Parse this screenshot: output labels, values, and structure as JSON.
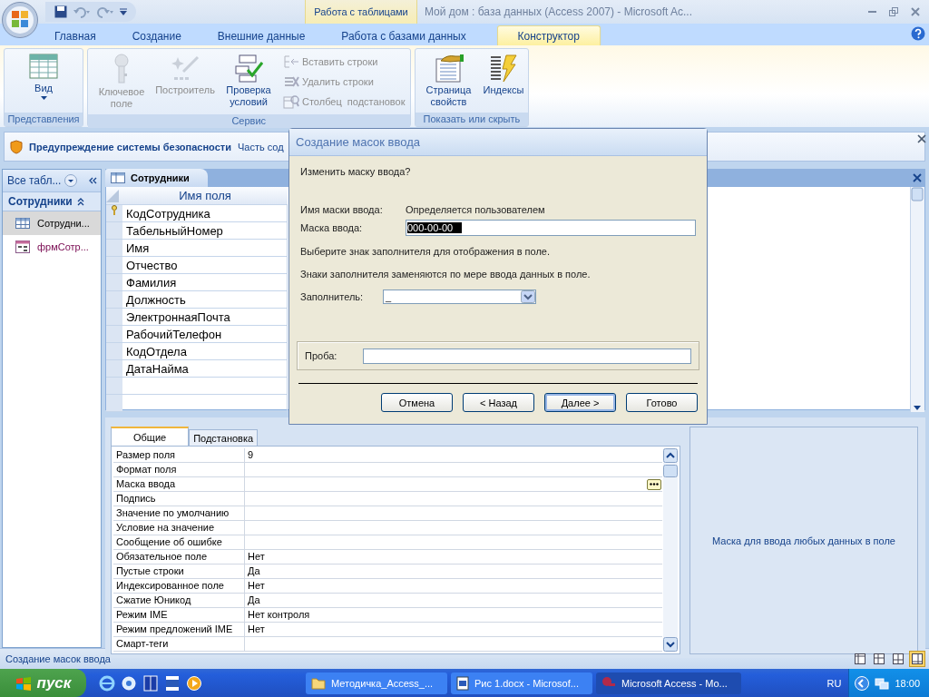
{
  "window": {
    "title": "Мой дом : база данных (Access 2007) - Microsoft Ac...",
    "contextual_group": "Работа с таблицами"
  },
  "ribbon_tabs": [
    {
      "label": "Главная",
      "selected": false
    },
    {
      "label": "Создание",
      "selected": false
    },
    {
      "label": "Внешние данные",
      "selected": false
    },
    {
      "label": "Работа с базами данных",
      "selected": false
    },
    {
      "label": "Конструктор",
      "selected": true
    }
  ],
  "ribbon_groups": [
    {
      "label": "Представления",
      "buttons": [
        {
          "label": "Вид",
          "kind": "menu",
          "disabled": false
        }
      ]
    },
    {
      "label": "Сервис",
      "buttons": [
        {
          "label": "Ключевое поле",
          "kind": "large",
          "disabled": true
        },
        {
          "label": "Построитель",
          "kind": "large",
          "disabled": true
        },
        {
          "label": "Проверка условий",
          "kind": "large",
          "disabled": false
        },
        {
          "label": "Вставить строки",
          "kind": "small",
          "disabled": true
        },
        {
          "label": "Удалить строки",
          "kind": "small",
          "disabled": true
        },
        {
          "label": "Столбец  подстановок",
          "kind": "small",
          "disabled": true
        }
      ]
    },
    {
      "label": "Показать или скрыть",
      "buttons": [
        {
          "label": "Страница свойств",
          "kind": "large",
          "disabled": false
        },
        {
          "label": "Индексы",
          "kind": "large",
          "disabled": false
        }
      ]
    }
  ],
  "security_bar": {
    "title": "Предупреждение системы безопасности",
    "text": "Часть сод"
  },
  "nav_pane": {
    "header": "Все табл...",
    "group": {
      "label": "Сотрудники",
      "expanded": true
    },
    "items": [
      {
        "label": "Сотрудни...",
        "kind": "table",
        "selected": true
      },
      {
        "label": "фрмСотр...",
        "kind": "form",
        "selected": false
      }
    ]
  },
  "document_tab": {
    "label": "Сотрудники"
  },
  "design_grid": {
    "column": "Имя поля",
    "rows": [
      {
        "name": "КодСотрудника",
        "primary_key": true
      },
      {
        "name": "ТабельныйНомер",
        "primary_key": false
      },
      {
        "name": "Имя",
        "primary_key": false
      },
      {
        "name": "Отчество",
        "primary_key": false
      },
      {
        "name": "Фамилия",
        "primary_key": false
      },
      {
        "name": "Должность",
        "primary_key": false
      },
      {
        "name": "ЭлектроннаяПочта",
        "primary_key": false
      },
      {
        "name": "РабочийТелефон",
        "primary_key": false
      },
      {
        "name": "КодОтдела",
        "primary_key": false
      },
      {
        "name": "ДатаНайма",
        "primary_key": false
      }
    ]
  },
  "field_properties": {
    "tabs": [
      {
        "label": "Общие",
        "selected": true
      },
      {
        "label": "Подстановка",
        "selected": false
      }
    ],
    "rows": [
      {
        "label": "Размер поля",
        "value": "9",
        "has_builder": false
      },
      {
        "label": "Формат поля",
        "has_builder": false
      },
      {
        "label": "Маска ввода",
        "has_builder": true
      },
      {
        "label": "Подпись",
        "has_builder": false
      },
      {
        "label": "Значение по умолчанию",
        "has_builder": false
      },
      {
        "label": "Условие на значение",
        "has_builder": false
      },
      {
        "label": "Сообщение об ошибке",
        "has_builder": false
      },
      {
        "label": "Обязательное поле",
        "value": "Нет",
        "has_builder": false
      },
      {
        "label": "Пустые строки",
        "value": "Да",
        "has_builder": false
      },
      {
        "label": "Индексированное поле",
        "value": "Нет",
        "has_builder": false
      },
      {
        "label": "Сжатие Юникод",
        "value": "Да",
        "has_builder": false
      },
      {
        "label": "Режим IME",
        "value": "Нет контроля",
        "has_builder": false
      },
      {
        "label": "Режим предложений IME",
        "value": "Нет",
        "has_builder": false
      },
      {
        "label": "Смарт-теги",
        "has_builder": false
      }
    ],
    "help": "Маска для ввода любых данных в поле"
  },
  "dialog": {
    "title": "Создание масок ввода",
    "question": "Изменить маску ввода?",
    "mask_name": {
      "label": "Имя маски ввода:",
      "value": "Определяется пользователем"
    },
    "mask": {
      "label": "Маска ввода:",
      "value": "000-00-00",
      "value_selected": true
    },
    "hints": [
      "Выберите знак заполнителя для отображения в поле.",
      "Знаки заполнителя заменяются по мере ввода данных в поле."
    ],
    "placeholder_char": {
      "label": "Заполнитель:",
      "value": "_"
    },
    "test": {
      "label": "Проба:"
    },
    "buttons": [
      {
        "label": "Отмена",
        "default": false
      },
      {
        "label": "< Назад",
        "default": false
      },
      {
        "label": "Далее >",
        "default": true
      },
      {
        "label": "Готово",
        "default": false
      }
    ]
  },
  "status_bar": {
    "text": "Создание масок ввода",
    "views": [
      {
        "selected": false
      },
      {
        "selected": false
      },
      {
        "selected": false
      },
      {
        "selected": true
      }
    ]
  },
  "taskbar": {
    "start": "пуск",
    "tasks": [
      {
        "label": "Методичка_Access_...",
        "kind": "folder",
        "selected": false
      },
      {
        "label": "Рис 1.docx - Microsof...",
        "kind": "word",
        "selected": false
      },
      {
        "label": "Microsoft Access - Mo...",
        "kind": "access",
        "selected": true
      }
    ],
    "language": "RU",
    "clock": "18:00"
  }
}
